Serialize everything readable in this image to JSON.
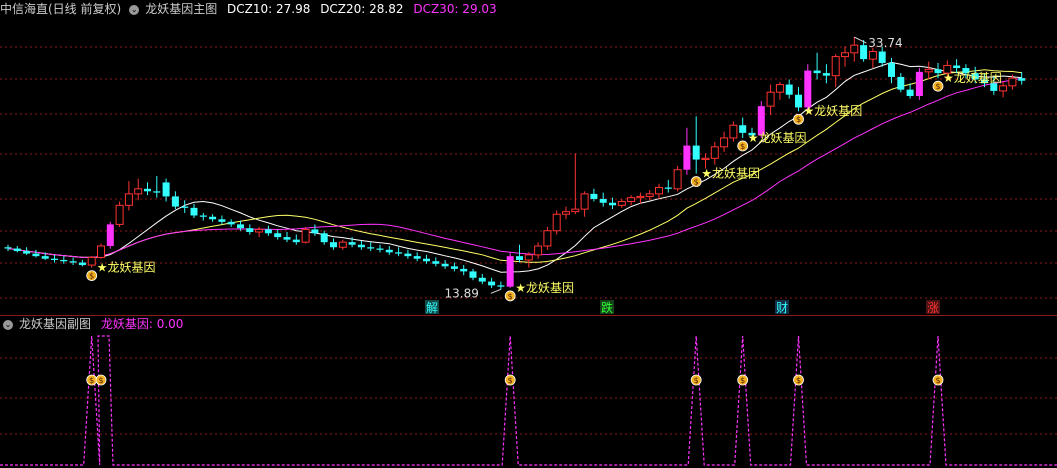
{
  "main_header": {
    "stock": "中信海直(日线 前复权)",
    "chart_name": "龙妖基因主图",
    "dcz10": "DCZ10: 27.98",
    "dcz20": "DCZ20: 28.82",
    "dcz30": "DCZ30: 29.03",
    "dcz_colors": {
      "dcz10": "#ffffff",
      "dcz20": "#ffff66",
      "dcz30": "#ff33ff"
    }
  },
  "sub_header": {
    "chart_name": "龙妖基因副图",
    "indicator": "龙妖基因: 0.00"
  },
  "annotations": {
    "high_label": "33.74",
    "low_label": "13.89",
    "signal_label": "★龙妖基因"
  },
  "bottom_tags": [
    "解",
    "跌",
    "财",
    "涨"
  ],
  "icons": {
    "signal": "money-bag-icon",
    "toggle": "chevron-circle-icon"
  },
  "colors": {
    "up": "#ff3333",
    "down": "#33ffff",
    "big_up": "#ff33ff",
    "ma10": "#ffffff",
    "ma20": "#ffff66",
    "ma30": "#ff33ff",
    "grid": "#8b1a1a"
  },
  "chart_data": {
    "type": "candlestick",
    "y_range_approx": [
      12.5,
      35
    ],
    "candles": [
      [
        17.2,
        17.4,
        16.9,
        17.1
      ],
      [
        17.1,
        17.3,
        16.8,
        16.9
      ],
      [
        16.9,
        17.2,
        16.6,
        16.7
      ],
      [
        16.7,
        17.0,
        16.4,
        16.5
      ],
      [
        16.5,
        16.8,
        16.2,
        16.3
      ],
      [
        16.3,
        16.6,
        16.0,
        16.2
      ],
      [
        16.2,
        16.5,
        15.9,
        16.1
      ],
      [
        16.1,
        16.4,
        15.8,
        16.0
      ],
      [
        16.0,
        16.2,
        15.7,
        15.8
      ],
      [
        15.8,
        16.5,
        15.6,
        16.4
      ],
      [
        16.4,
        17.5,
        16.3,
        17.3
      ],
      [
        17.3,
        19.2,
        17.1,
        19.0
      ],
      [
        19.0,
        20.8,
        18.8,
        20.5
      ],
      [
        20.5,
        22.4,
        20.1,
        21.4
      ],
      [
        21.4,
        22.6,
        20.9,
        21.8
      ],
      [
        21.8,
        22.3,
        21.3,
        21.6
      ],
      [
        21.6,
        22.8,
        21.1,
        21.5
      ],
      [
        22.3,
        22.6,
        20.8,
        21.2
      ],
      [
        21.2,
        21.6,
        20.2,
        20.4
      ],
      [
        20.4,
        20.9,
        19.9,
        20.3
      ],
      [
        20.3,
        20.6,
        19.5,
        19.7
      ],
      [
        19.7,
        19.9,
        19.3,
        19.6
      ],
      [
        19.6,
        19.8,
        19.2,
        19.4
      ],
      [
        19.4,
        19.7,
        19.0,
        19.2
      ],
      [
        19.2,
        19.4,
        18.8,
        19.0
      ],
      [
        19.0,
        19.3,
        18.5,
        18.7
      ],
      [
        18.7,
        19.0,
        18.2,
        18.4
      ],
      [
        18.4,
        18.8,
        18.0,
        18.6
      ],
      [
        18.6,
        18.9,
        18.1,
        18.3
      ],
      [
        18.3,
        18.6,
        17.8,
        18.0
      ],
      [
        18.0,
        18.4,
        17.6,
        17.8
      ],
      [
        17.8,
        18.2,
        17.4,
        17.6
      ],
      [
        17.6,
        18.8,
        17.5,
        18.6
      ],
      [
        18.6,
        19.0,
        18.1,
        18.3
      ],
      [
        18.3,
        18.5,
        17.4,
        17.6
      ],
      [
        17.6,
        17.9,
        17.0,
        17.2
      ],
      [
        17.2,
        17.8,
        17.0,
        17.6
      ],
      [
        17.6,
        18.0,
        17.2,
        17.4
      ],
      [
        17.4,
        17.7,
        17.0,
        17.2
      ],
      [
        17.2,
        17.6,
        16.9,
        17.1
      ],
      [
        17.1,
        17.4,
        16.8,
        17.0
      ],
      [
        17.0,
        17.3,
        16.6,
        16.8
      ],
      [
        16.8,
        17.2,
        16.5,
        16.7
      ],
      [
        16.7,
        17.0,
        16.3,
        16.5
      ],
      [
        16.5,
        16.8,
        16.1,
        16.3
      ],
      [
        16.3,
        16.6,
        15.9,
        16.1
      ],
      [
        16.1,
        16.4,
        15.7,
        15.9
      ],
      [
        15.9,
        16.2,
        15.5,
        15.7
      ],
      [
        15.7,
        16.0,
        15.3,
        15.5
      ],
      [
        15.5,
        15.8,
        15.0,
        15.3
      ],
      [
        15.3,
        15.5,
        14.6,
        14.8
      ],
      [
        14.8,
        15.1,
        14.3,
        14.5
      ],
      [
        14.5,
        14.8,
        14.0,
        14.2
      ],
      [
        14.2,
        14.5,
        13.89,
        14.1
      ],
      [
        14.1,
        16.8,
        14.0,
        16.5
      ],
      [
        16.5,
        17.4,
        16.0,
        16.2
      ],
      [
        16.2,
        16.8,
        15.6,
        16.6
      ],
      [
        16.6,
        17.6,
        16.3,
        17.3
      ],
      [
        17.3,
        18.8,
        17.0,
        18.5
      ],
      [
        18.5,
        20.1,
        18.2,
        19.8
      ],
      [
        19.8,
        20.4,
        19.4,
        20.0
      ],
      [
        20.0,
        24.6,
        19.8,
        20.2
      ],
      [
        20.2,
        21.6,
        19.6,
        21.4
      ],
      [
        21.4,
        21.8,
        20.8,
        21.0
      ],
      [
        21.0,
        21.5,
        20.4,
        20.7
      ],
      [
        20.7,
        21.1,
        20.2,
        20.5
      ],
      [
        20.5,
        21.0,
        20.3,
        20.8
      ],
      [
        20.8,
        21.3,
        20.5,
        21.1
      ],
      [
        21.1,
        21.5,
        20.6,
        21.2
      ],
      [
        21.2,
        21.7,
        20.9,
        21.4
      ],
      [
        21.4,
        22.2,
        21.0,
        21.9
      ],
      [
        21.9,
        22.5,
        21.5,
        21.8
      ],
      [
        21.8,
        23.6,
        21.6,
        23.3
      ],
      [
        23.3,
        26.6,
        22.9,
        25.2
      ],
      [
        25.2,
        27.5,
        23.0,
        24.1
      ],
      [
        24.1,
        24.6,
        23.4,
        24.2
      ],
      [
        24.2,
        25.5,
        23.7,
        25.1
      ],
      [
        25.1,
        26.3,
        24.7,
        25.8
      ],
      [
        25.8,
        27.1,
        25.5,
        26.8
      ],
      [
        26.8,
        27.4,
        25.8,
        26.2
      ],
      [
        26.2,
        26.6,
        25.6,
        26.0
      ],
      [
        26.0,
        28.7,
        25.8,
        28.3
      ],
      [
        28.3,
        30.0,
        27.6,
        29.4
      ],
      [
        29.4,
        30.2,
        28.8,
        30.0
      ],
      [
        30.0,
        30.4,
        28.9,
        29.2
      ],
      [
        29.2,
        29.8,
        27.9,
        28.2
      ],
      [
        28.2,
        31.6,
        27.9,
        31.1
      ],
      [
        31.1,
        32.5,
        30.4,
        30.9
      ],
      [
        30.9,
        31.6,
        30.1,
        30.7
      ],
      [
        30.7,
        32.4,
        29.8,
        32.2
      ],
      [
        32.2,
        33.0,
        31.4,
        32.5
      ],
      [
        32.5,
        33.74,
        31.8,
        33.1
      ],
      [
        33.1,
        33.5,
        31.8,
        32.0
      ],
      [
        32.0,
        32.9,
        31.3,
        32.6
      ],
      [
        32.6,
        33.0,
        31.4,
        31.7
      ],
      [
        31.7,
        32.1,
        30.1,
        30.6
      ],
      [
        30.6,
        30.9,
        29.4,
        29.6
      ],
      [
        29.6,
        30.1,
        28.9,
        29.1
      ],
      [
        29.1,
        31.3,
        28.8,
        31.0
      ],
      [
        31.0,
        31.8,
        30.4,
        31.2
      ],
      [
        31.2,
        31.7,
        30.5,
        30.9
      ],
      [
        30.9,
        31.9,
        30.3,
        31.5
      ],
      [
        31.5,
        32.0,
        30.9,
        31.3
      ],
      [
        31.3,
        31.6,
        30.5,
        30.9
      ],
      [
        30.9,
        31.4,
        30.1,
        30.4
      ],
      [
        30.4,
        30.9,
        29.8,
        30.1
      ],
      [
        30.1,
        30.6,
        29.2,
        29.5
      ],
      [
        29.5,
        30.2,
        29.0,
        29.9
      ],
      [
        29.9,
        30.8,
        29.6,
        30.5
      ],
      [
        30.5,
        31.0,
        30.0,
        30.3
      ]
    ],
    "signal_indices": [
      9,
      54,
      74,
      79,
      85,
      100
    ],
    "sub_indicator": {
      "name": "龙妖基因",
      "value": 0.0,
      "spike_indices": [
        9,
        10,
        54,
        74,
        79,
        85,
        100
      ]
    }
  }
}
